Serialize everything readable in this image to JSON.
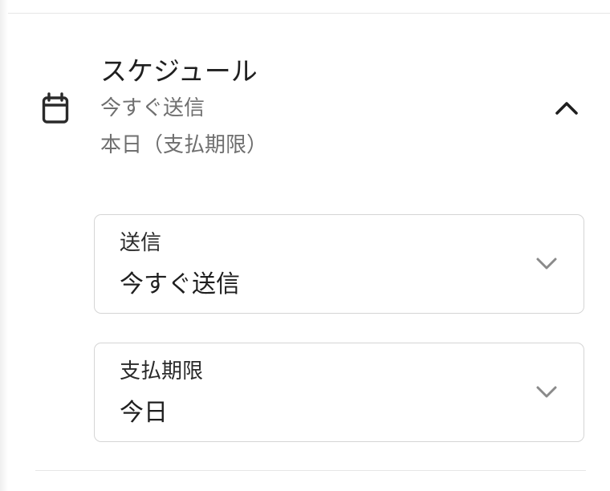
{
  "schedule": {
    "title": "スケジュール",
    "summary_send": "今すぐ送信",
    "summary_due": "本日（支払期限）",
    "icon": "calendar-icon",
    "toggle_icon": "chevron-up-icon",
    "expanded": true
  },
  "fields": {
    "send": {
      "label": "送信",
      "value": "今すぐ送信",
      "icon": "chevron-down-icon"
    },
    "due_date": {
      "label": "支払期限",
      "value": "今日",
      "icon": "chevron-down-icon"
    }
  },
  "colors": {
    "text_primary": "#1f1f1f",
    "text_secondary": "#6f6f6f",
    "border": "#d5d5d5",
    "chevron": "#8a8a8a",
    "divider": "#e6e6e6"
  }
}
